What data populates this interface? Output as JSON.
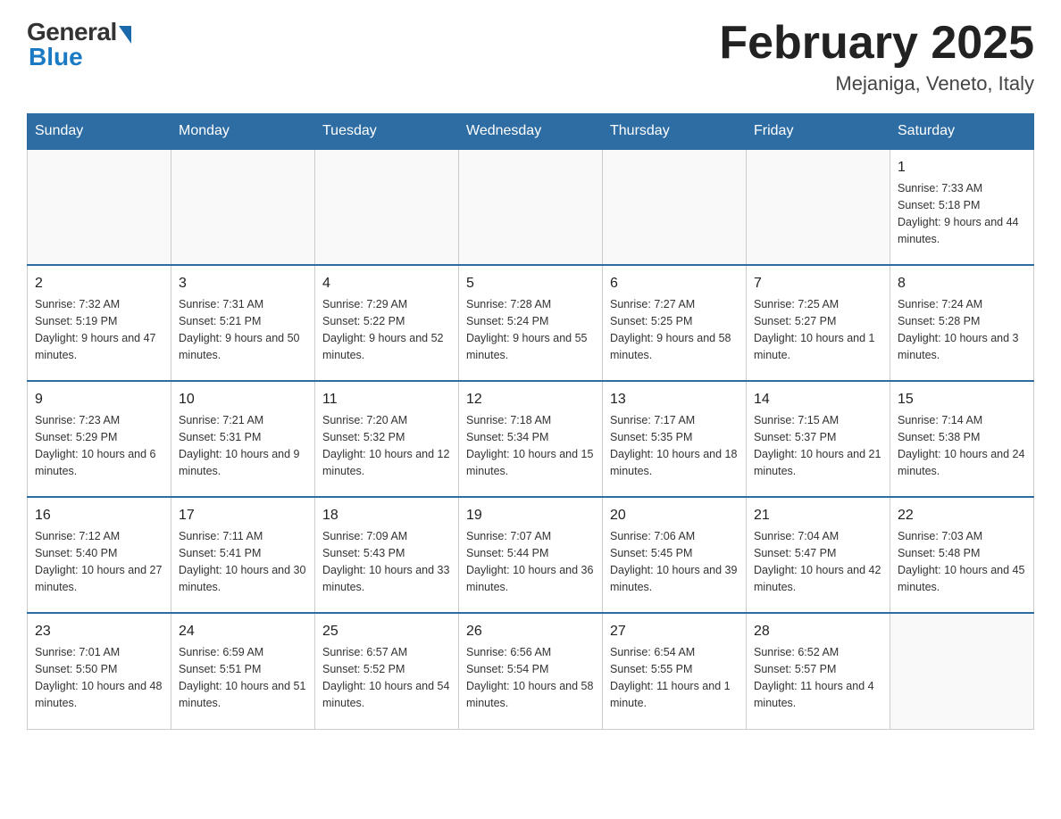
{
  "header": {
    "logo": {
      "general_text": "General",
      "blue_text": "Blue"
    },
    "title": "February 2025",
    "location": "Mejaniga, Veneto, Italy"
  },
  "days_of_week": [
    "Sunday",
    "Monday",
    "Tuesday",
    "Wednesday",
    "Thursday",
    "Friday",
    "Saturday"
  ],
  "weeks": [
    [
      {
        "day": "",
        "info": ""
      },
      {
        "day": "",
        "info": ""
      },
      {
        "day": "",
        "info": ""
      },
      {
        "day": "",
        "info": ""
      },
      {
        "day": "",
        "info": ""
      },
      {
        "day": "",
        "info": ""
      },
      {
        "day": "1",
        "info": "Sunrise: 7:33 AM\nSunset: 5:18 PM\nDaylight: 9 hours and 44 minutes."
      }
    ],
    [
      {
        "day": "2",
        "info": "Sunrise: 7:32 AM\nSunset: 5:19 PM\nDaylight: 9 hours and 47 minutes."
      },
      {
        "day": "3",
        "info": "Sunrise: 7:31 AM\nSunset: 5:21 PM\nDaylight: 9 hours and 50 minutes."
      },
      {
        "day": "4",
        "info": "Sunrise: 7:29 AM\nSunset: 5:22 PM\nDaylight: 9 hours and 52 minutes."
      },
      {
        "day": "5",
        "info": "Sunrise: 7:28 AM\nSunset: 5:24 PM\nDaylight: 9 hours and 55 minutes."
      },
      {
        "day": "6",
        "info": "Sunrise: 7:27 AM\nSunset: 5:25 PM\nDaylight: 9 hours and 58 minutes."
      },
      {
        "day": "7",
        "info": "Sunrise: 7:25 AM\nSunset: 5:27 PM\nDaylight: 10 hours and 1 minute."
      },
      {
        "day": "8",
        "info": "Sunrise: 7:24 AM\nSunset: 5:28 PM\nDaylight: 10 hours and 3 minutes."
      }
    ],
    [
      {
        "day": "9",
        "info": "Sunrise: 7:23 AM\nSunset: 5:29 PM\nDaylight: 10 hours and 6 minutes."
      },
      {
        "day": "10",
        "info": "Sunrise: 7:21 AM\nSunset: 5:31 PM\nDaylight: 10 hours and 9 minutes."
      },
      {
        "day": "11",
        "info": "Sunrise: 7:20 AM\nSunset: 5:32 PM\nDaylight: 10 hours and 12 minutes."
      },
      {
        "day": "12",
        "info": "Sunrise: 7:18 AM\nSunset: 5:34 PM\nDaylight: 10 hours and 15 minutes."
      },
      {
        "day": "13",
        "info": "Sunrise: 7:17 AM\nSunset: 5:35 PM\nDaylight: 10 hours and 18 minutes."
      },
      {
        "day": "14",
        "info": "Sunrise: 7:15 AM\nSunset: 5:37 PM\nDaylight: 10 hours and 21 minutes."
      },
      {
        "day": "15",
        "info": "Sunrise: 7:14 AM\nSunset: 5:38 PM\nDaylight: 10 hours and 24 minutes."
      }
    ],
    [
      {
        "day": "16",
        "info": "Sunrise: 7:12 AM\nSunset: 5:40 PM\nDaylight: 10 hours and 27 minutes."
      },
      {
        "day": "17",
        "info": "Sunrise: 7:11 AM\nSunset: 5:41 PM\nDaylight: 10 hours and 30 minutes."
      },
      {
        "day": "18",
        "info": "Sunrise: 7:09 AM\nSunset: 5:43 PM\nDaylight: 10 hours and 33 minutes."
      },
      {
        "day": "19",
        "info": "Sunrise: 7:07 AM\nSunset: 5:44 PM\nDaylight: 10 hours and 36 minutes."
      },
      {
        "day": "20",
        "info": "Sunrise: 7:06 AM\nSunset: 5:45 PM\nDaylight: 10 hours and 39 minutes."
      },
      {
        "day": "21",
        "info": "Sunrise: 7:04 AM\nSunset: 5:47 PM\nDaylight: 10 hours and 42 minutes."
      },
      {
        "day": "22",
        "info": "Sunrise: 7:03 AM\nSunset: 5:48 PM\nDaylight: 10 hours and 45 minutes."
      }
    ],
    [
      {
        "day": "23",
        "info": "Sunrise: 7:01 AM\nSunset: 5:50 PM\nDaylight: 10 hours and 48 minutes."
      },
      {
        "day": "24",
        "info": "Sunrise: 6:59 AM\nSunset: 5:51 PM\nDaylight: 10 hours and 51 minutes."
      },
      {
        "day": "25",
        "info": "Sunrise: 6:57 AM\nSunset: 5:52 PM\nDaylight: 10 hours and 54 minutes."
      },
      {
        "day": "26",
        "info": "Sunrise: 6:56 AM\nSunset: 5:54 PM\nDaylight: 10 hours and 58 minutes."
      },
      {
        "day": "27",
        "info": "Sunrise: 6:54 AM\nSunset: 5:55 PM\nDaylight: 11 hours and 1 minute."
      },
      {
        "day": "28",
        "info": "Sunrise: 6:52 AM\nSunset: 5:57 PM\nDaylight: 11 hours and 4 minutes."
      },
      {
        "day": "",
        "info": ""
      }
    ]
  ]
}
